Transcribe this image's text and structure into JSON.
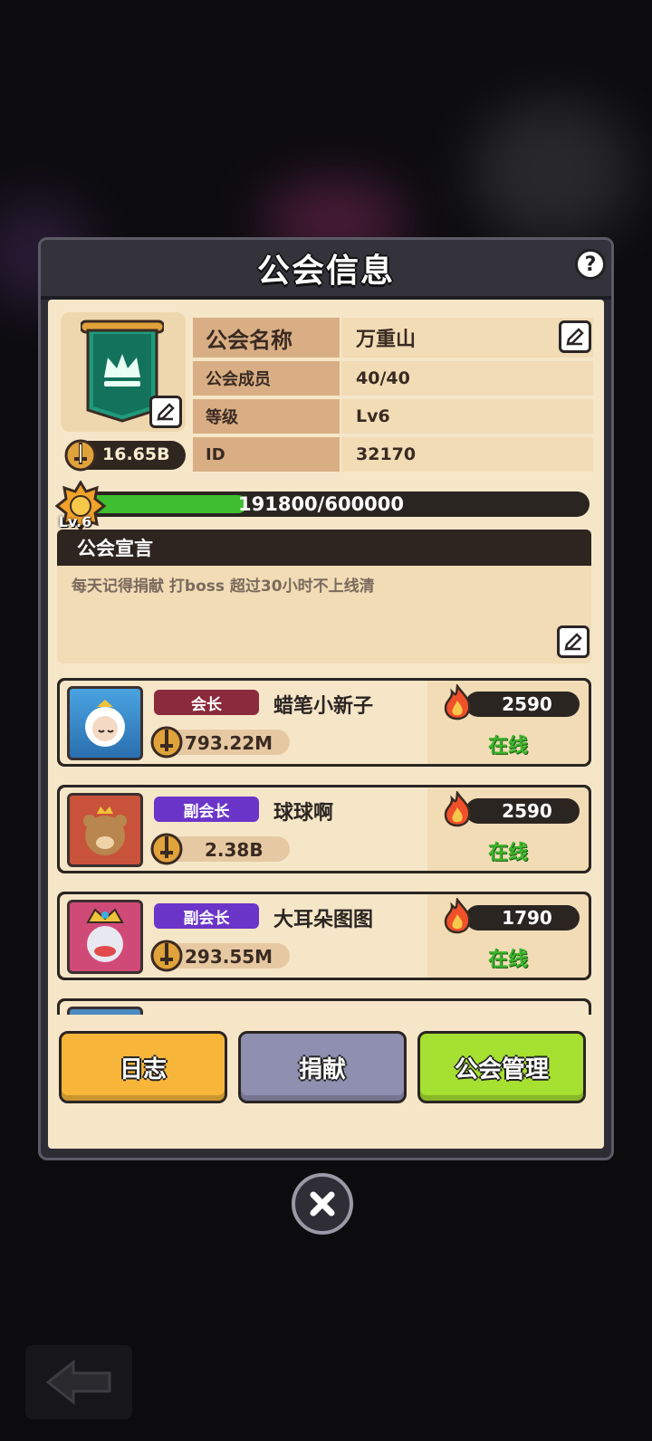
{
  "panel": {
    "title": "公会信息",
    "help_label": "?"
  },
  "guild": {
    "power": "16.65B",
    "fields": [
      {
        "label": "公会名称",
        "value": "万重山"
      },
      {
        "label": "公会成员",
        "value": "40/40"
      },
      {
        "label": "等级",
        "value": "Lv6"
      },
      {
        "label": "ID",
        "value": "32170"
      }
    ],
    "level_badge": "Lv.6",
    "progress_text": "191800/600000",
    "progress_fraction": 0.3197
  },
  "declaration": {
    "heading": "公会宣言",
    "text": "每天记得捐献 打boss  超过30小时不上线清"
  },
  "members": [
    {
      "role": "会长",
      "name": "蜡笔小新子",
      "power": "793.22M",
      "activity": "2590",
      "status": "在线",
      "role_color": "#8b2a3c"
    },
    {
      "role": "副会长",
      "name": "球球啊",
      "power": "2.38B",
      "activity": "2590",
      "status": "在线",
      "role_color": "#6b35c9"
    },
    {
      "role": "副会长",
      "name": "大耳朵图图",
      "power": "293.55M",
      "activity": "1790",
      "status": "在线",
      "role_color": "#6b35c9"
    }
  ],
  "buttons": {
    "log": "日志",
    "donate": "捐献",
    "manage": "公会管理"
  },
  "icons": {
    "help": "help-icon",
    "edit": "edit-icon",
    "close": "close-icon",
    "back": "back-arrow-icon",
    "emblem": "crown-banner-icon",
    "sword": "sword-icon",
    "flame": "flame-icon"
  }
}
